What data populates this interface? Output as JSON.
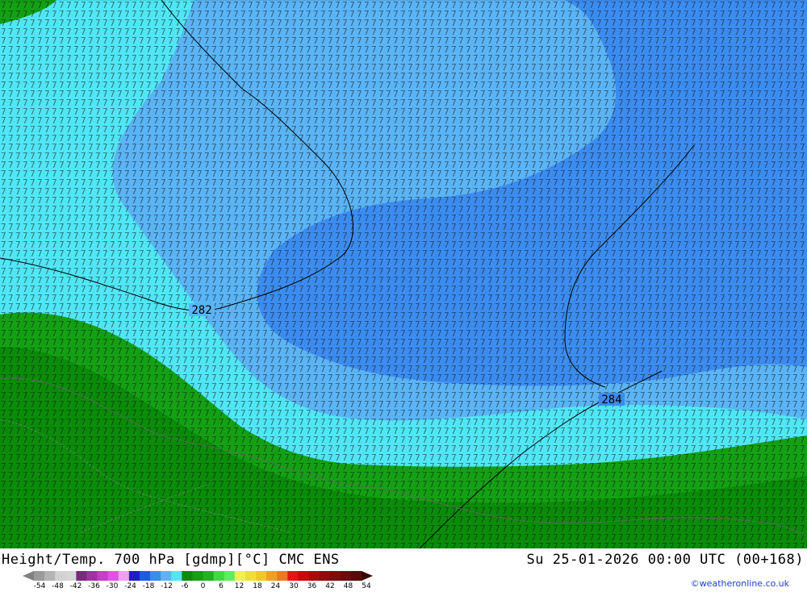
{
  "footer": {
    "title_left": "Height/Temp. 700 hPa [gdmp][°C] CMC ENS",
    "title_right": "Su 25-01-2026 00:00 UTC (00+168)",
    "credit": "©weatheronline.co.uk"
  },
  "colorbar": {
    "ticks": [
      "-54",
      "-48",
      "-42",
      "-36",
      "-30",
      "-24",
      "-18",
      "-12",
      "-6",
      "0",
      "6",
      "12",
      "18",
      "24",
      "30",
      "36",
      "42",
      "48",
      "54"
    ],
    "colors": [
      "#9a9a9a",
      "#b4b4b4",
      "#d2d2d2",
      "#d6d6d6",
      "#7a2a7a",
      "#a032a0",
      "#c83cc8",
      "#e650e6",
      "#f0a0f0",
      "#1e1ec8",
      "#1e5ae6",
      "#3c8cf0",
      "#5ab4f5",
      "#50e6f5",
      "#0a8c0a",
      "#14a014",
      "#1eb41e",
      "#3cdc3c",
      "#5af05a",
      "#f0f050",
      "#f0dc3c",
      "#f0c828",
      "#f0a01e",
      "#f0781e",
      "#e61414",
      "#c80a0a",
      "#aa0a0a",
      "#960a0a",
      "#820a0a",
      "#6e0a0a",
      "#5a0a0a"
    ]
  },
  "map": {
    "fill_colors": {
      "dark_green": "#0a8c0a",
      "green": "#14a014",
      "cyan": "#50e6f5",
      "light_blue": "#5ab4f5",
      "blue": "#3c8cf0"
    },
    "contour_labels": [
      "282",
      "284"
    ]
  }
}
